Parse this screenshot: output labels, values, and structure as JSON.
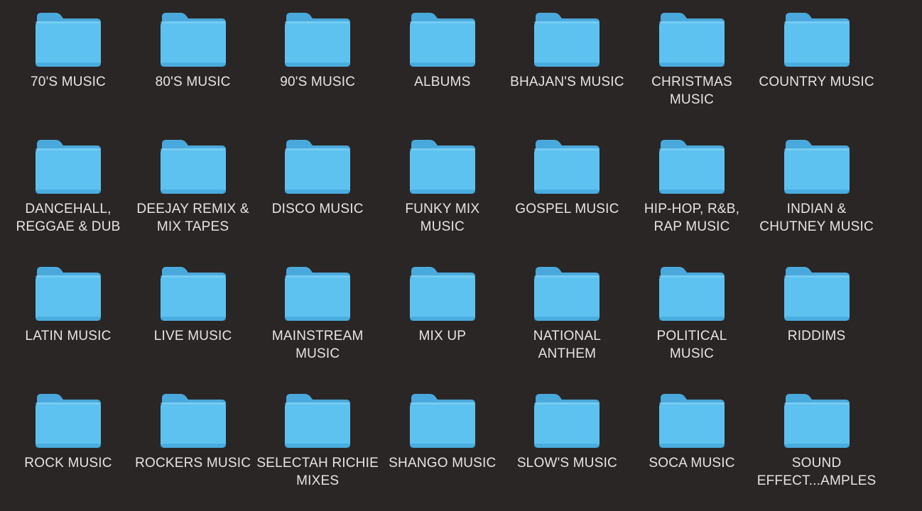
{
  "window": {
    "background": "#2a2625",
    "view": "icon-grid"
  },
  "colors": {
    "folder_body": "#5ec2f0",
    "folder_tab": "#4aa9dc",
    "label_text": "#e6e4e2"
  },
  "folders": [
    {
      "label": "70'S MUSIC",
      "icon": "folder-icon"
    },
    {
      "label": "80'S MUSIC",
      "icon": "folder-icon"
    },
    {
      "label": "90'S MUSIC",
      "icon": "folder-icon"
    },
    {
      "label": "ALBUMS",
      "icon": "folder-icon"
    },
    {
      "label": "BHAJAN'S MUSIC",
      "icon": "folder-icon"
    },
    {
      "label": "CHRISTMAS\nMUSIC",
      "icon": "folder-icon"
    },
    {
      "label": "COUNTRY MUSIC",
      "icon": "folder-icon"
    },
    {
      "label": "DANCEHALL,\nREGGAE & DUB",
      "icon": "folder-icon"
    },
    {
      "label": "DEEJAY REMIX &\nMIX TAPES",
      "icon": "folder-icon"
    },
    {
      "label": "DISCO MUSIC",
      "icon": "folder-icon"
    },
    {
      "label": "FUNKY MIX\nMUSIC",
      "icon": "folder-icon"
    },
    {
      "label": "GOSPEL MUSIC",
      "icon": "folder-icon"
    },
    {
      "label": "HIP-HOP, R&B,\nRAP MUSIC",
      "icon": "folder-icon"
    },
    {
      "label": "INDIAN &\nCHUTNEY MUSIC",
      "icon": "folder-icon"
    },
    {
      "label": "LATIN MUSIC",
      "icon": "folder-icon"
    },
    {
      "label": "LIVE MUSIC",
      "icon": "folder-icon"
    },
    {
      "label": "MAINSTREAM\nMUSIC",
      "icon": "folder-icon"
    },
    {
      "label": "MIX UP",
      "icon": "folder-icon"
    },
    {
      "label": "NATIONAL\nANTHEM",
      "icon": "folder-icon"
    },
    {
      "label": "POLITICAL\nMUSIC",
      "icon": "folder-icon"
    },
    {
      "label": "RIDDIMS",
      "icon": "folder-icon"
    },
    {
      "label": "ROCK MUSIC",
      "icon": "folder-icon"
    },
    {
      "label": "ROCKERS MUSIC",
      "icon": "folder-icon"
    },
    {
      "label": "SELECTAH RICHIE\nMIXES",
      "icon": "folder-icon"
    },
    {
      "label": "SHANGO MUSIC",
      "icon": "folder-icon"
    },
    {
      "label": "SLOW'S MUSIC",
      "icon": "folder-icon"
    },
    {
      "label": "SOCA MUSIC",
      "icon": "folder-icon"
    },
    {
      "label": "SOUND\nEFFECT...AMPLES",
      "icon": "folder-icon"
    }
  ]
}
